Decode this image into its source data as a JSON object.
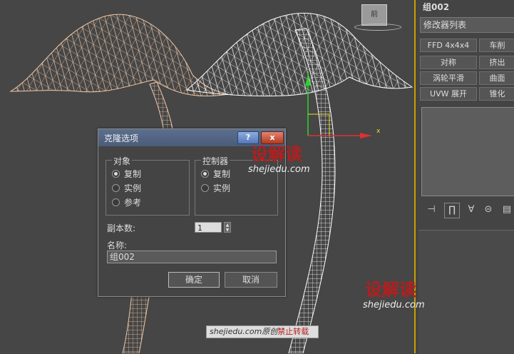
{
  "viewport": {
    "viewcube_label": "前",
    "axis_x_label": "x"
  },
  "panel": {
    "object_name": "组002",
    "modifier_list_label": "修改器列表",
    "buttons": [
      "FFD 4x4x4",
      "车削",
      "对称",
      "挤出",
      "涡轮平滑",
      "曲面",
      "UVW 展开",
      "锥化"
    ],
    "tools": [
      "pin-stack-icon",
      "show-end-result-icon",
      "make-unique-icon",
      "remove-modifier-icon",
      "configure-modifier-sets-icon"
    ]
  },
  "dialog": {
    "title": "克隆选项",
    "help": "?",
    "close": "x",
    "object_group": {
      "label": "对象",
      "options": [
        {
          "label": "复制",
          "selected": true
        },
        {
          "label": "实例",
          "selected": false
        },
        {
          "label": "参考",
          "selected": false
        }
      ]
    },
    "controller_group": {
      "label": "控制器",
      "options": [
        {
          "label": "复制",
          "selected": true
        },
        {
          "label": "实例",
          "selected": false
        }
      ]
    },
    "copies_label": "副本数:",
    "copies_value": "1",
    "name_label": "名称:",
    "name_value": "组002",
    "ok": "确定",
    "cancel": "取消"
  },
  "watermarks": {
    "logo": "设解读",
    "url": "shejiedu.com",
    "credit_prefix": "shejiedu.com原创",
    "credit_suffix": "禁止转载"
  },
  "colors": {
    "left_mesh": "#f0c8a8",
    "right_mesh": "#ffffff",
    "accent": "#c8a000",
    "watermark": "#b51e1e"
  }
}
